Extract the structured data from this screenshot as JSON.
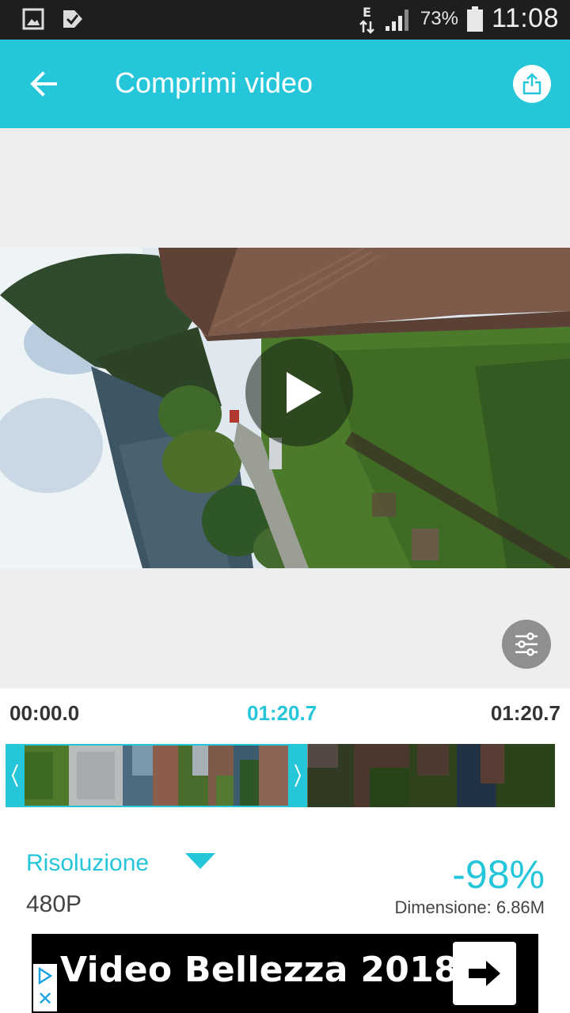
{
  "status_bar": {
    "network_type": "E",
    "battery_percent": "73%",
    "time": "11:08"
  },
  "app_bar": {
    "title": "Comprimi video",
    "accent_color": "#26c6da"
  },
  "timeline": {
    "start_time": "00:00.0",
    "current_time": "01:20.7",
    "end_time": "01:20.7"
  },
  "compression": {
    "resolution_label": "Risoluzione",
    "resolution_value": "480P",
    "reduction": "-98%",
    "size_label": "Dimensione: 6.86M"
  },
  "ad": {
    "text": "Video Bellezza 2018"
  },
  "icons": {
    "back": "arrow-left-icon",
    "share": "share-icon",
    "play": "play-icon",
    "settings": "sliders-icon",
    "dropdown": "triangle-down-icon",
    "ad_arrow": "arrow-right-icon"
  }
}
